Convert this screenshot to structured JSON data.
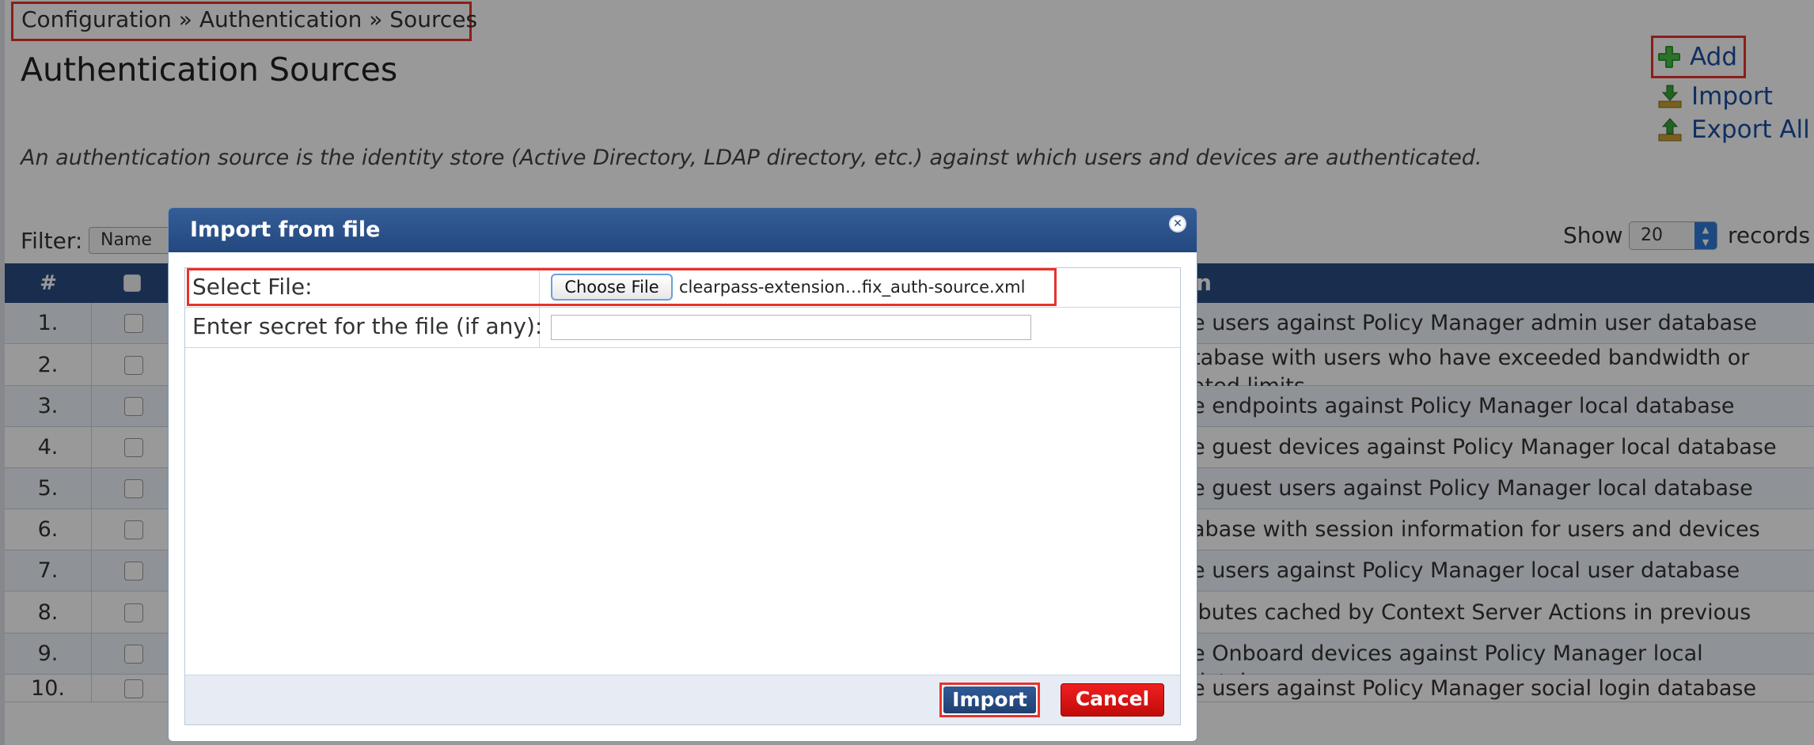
{
  "breadcrumb": "Configuration » Authentication » Sources",
  "page": {
    "title": "Authentication Sources",
    "description": "An authentication source is the identity store (Active Directory, LDAP directory, etc.) against which users and devices are authenticated."
  },
  "actions": {
    "add": "Add",
    "import": "Import",
    "export_all": "Export All"
  },
  "filter": {
    "label": "Filter:",
    "selected": "Name"
  },
  "pagination": {
    "show_label": "Show",
    "page_size": "20",
    "records_label": "records"
  },
  "table": {
    "headers": {
      "num": "#",
      "description": "n"
    },
    "rows": [
      {
        "num": "1.",
        "desc": "e users against Policy Manager admin user database"
      },
      {
        "num": "2.",
        "desc": "tabase with users who have exceeded bandwidth or\nated limits"
      },
      {
        "num": "3.",
        "desc": "e endpoints against Policy Manager local database"
      },
      {
        "num": "4.",
        "desc": "e guest devices against Policy Manager local database"
      },
      {
        "num": "5.",
        "desc": "e guest users against Policy Manager local database"
      },
      {
        "num": "6.",
        "desc": "abase with session information for users and devices"
      },
      {
        "num": "7.",
        "desc": "e users against Policy Manager local user database"
      },
      {
        "num": "8.",
        "desc": "ibutes cached by Context Server Actions in previous"
      },
      {
        "num": "9.",
        "desc": "e Onboard devices against Policy Manager local database"
      },
      {
        "num": "10.",
        "desc": "e users against Policy Manager social login database"
      }
    ]
  },
  "dialog": {
    "title": "Import from file",
    "select_file_label": "Select File:",
    "choose_file_label": "Choose File",
    "file_name": "clearpass-extension…fix_auth-source.xml",
    "secret_label": "Enter secret for the file (if any):",
    "secret_value": "",
    "import_label": "Import",
    "cancel_label": "Cancel"
  },
  "colors": {
    "header_blue": "#2a4d82",
    "link_blue": "#1a4fa0",
    "highlight_red": "#e8322b",
    "cancel_red": "#d31010"
  }
}
